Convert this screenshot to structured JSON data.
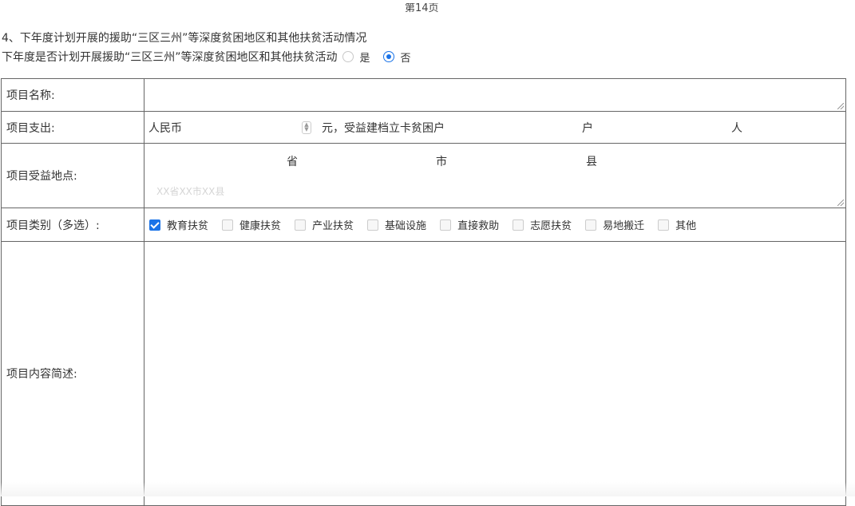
{
  "page": {
    "number": "第14页"
  },
  "section": {
    "title": "4、下年度计划开展的援助“三区三州”等深度贫困地区和其他扶贫活动情况"
  },
  "question": {
    "text": "下年度是否计划开展援助“三区三州”等深度贫困地区和其他扶贫活动",
    "options": [
      {
        "label": "是",
        "selected": false
      },
      {
        "label": "否",
        "selected": true
      }
    ]
  },
  "form": {
    "name_label": "项目名称:",
    "expense": {
      "label": "项目支出:",
      "currency": "人民币",
      "unit_text": "元，受益建档立卡贫困户",
      "household_unit": "户",
      "person_unit": "人"
    },
    "location": {
      "label": "项目受益地点:",
      "province": "省",
      "city": "市",
      "county": "县",
      "placeholder": "XX省XX市XX县"
    },
    "category": {
      "label": "项目类别（多选）:",
      "options": [
        {
          "label": "教育扶贫",
          "checked": true
        },
        {
          "label": "健康扶贫",
          "checked": false
        },
        {
          "label": "产业扶贫",
          "checked": false
        },
        {
          "label": "基础设施",
          "checked": false
        },
        {
          "label": "直接救助",
          "checked": false
        },
        {
          "label": "志愿扶贫",
          "checked": false
        },
        {
          "label": "易地搬迁",
          "checked": false
        },
        {
          "label": "其他",
          "checked": false
        }
      ]
    },
    "description_label": "项目内容简述:"
  },
  "colors": {
    "accent": "#1a73e8",
    "border": "#666666"
  }
}
